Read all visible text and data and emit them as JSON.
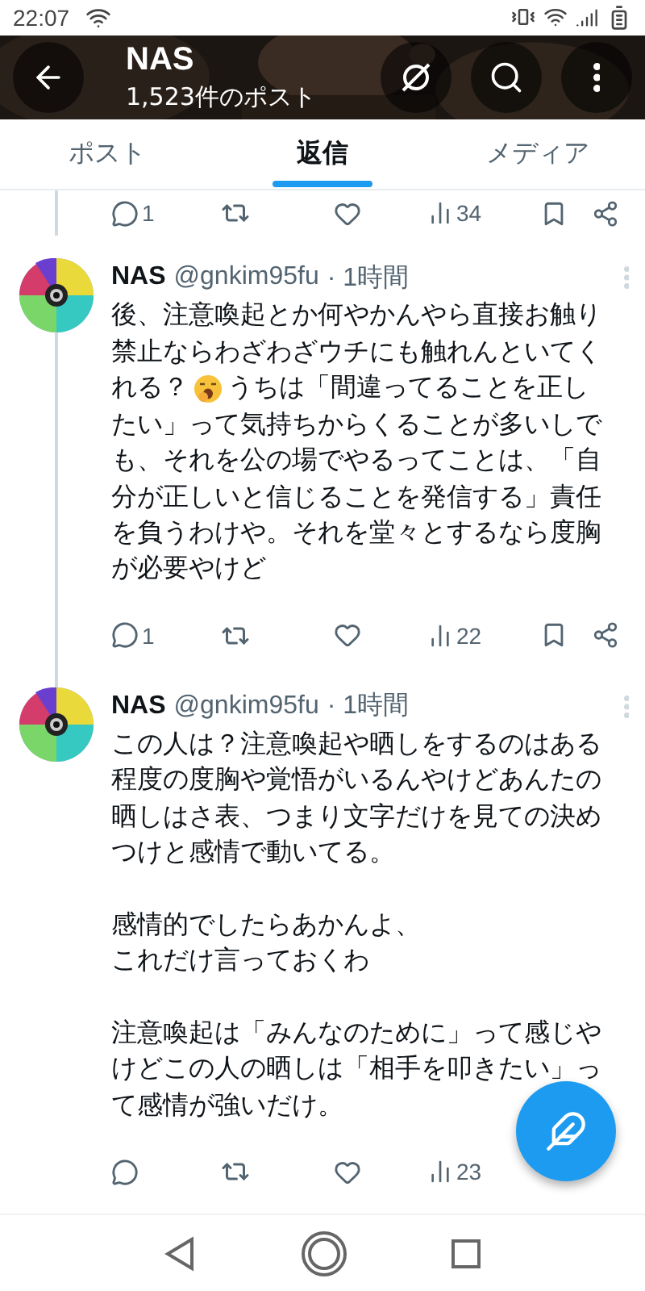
{
  "status_bar": {
    "time": "22:07"
  },
  "header": {
    "title": "NAS",
    "subtitle": "1,523件のポスト"
  },
  "tabs": [
    {
      "label": "ポスト",
      "selected": false
    },
    {
      "label": "返信",
      "selected": true
    },
    {
      "label": "メディア",
      "selected": false
    }
  ],
  "previous_actions": [
    {
      "kind": "reply",
      "count": "1"
    },
    {
      "kind": "retweet"
    },
    {
      "kind": "like"
    },
    {
      "kind": "views",
      "count": "34"
    },
    {
      "kind": "bookmark"
    },
    {
      "kind": "share"
    }
  ],
  "tweets": [
    {
      "name": "NAS",
      "handle": "@gnkim95fu",
      "time": "· 1時間",
      "thread_below": true,
      "blocks": [
        {
          "kind": "text",
          "text": "後、注意喚起とか何やかんやら直接お触り禁止ならわざわざウチにも触れんといてく"
        },
        {
          "kind": "emoji_line",
          "before": "れる？",
          "after": "うちは「間違ってることを正し"
        },
        {
          "kind": "text",
          "text": "たい」って気持ちからくることが多いしでも、それを公の場でやるってことは、「自分が正しいと信じることを発信する」責任を負うわけや。それを堂々とするなら度胸が必要やけど"
        }
      ],
      "actions": [
        {
          "kind": "reply",
          "count": "1"
        },
        {
          "kind": "retweet"
        },
        {
          "kind": "like"
        },
        {
          "kind": "views",
          "count": "22"
        },
        {
          "kind": "bookmark"
        },
        {
          "kind": "share"
        }
      ]
    },
    {
      "name": "NAS",
      "handle": "@gnkim95fu",
      "time": "· 1時間",
      "thread_below": false,
      "blocks": [
        {
          "kind": "text",
          "text": "この人は？注意喚起や晒しをするのはある程度の度胸や覚悟がいるんやけどあんたの晒しはさ表、つまり文字だけを見ての決めつけと感情で動いてる。"
        },
        {
          "kind": "gap"
        },
        {
          "kind": "text",
          "text": "感情的でしたらあかんよ、"
        },
        {
          "kind": "text",
          "text": "これだけ言っておくわ"
        },
        {
          "kind": "gap"
        },
        {
          "kind": "text",
          "text": "注意喚起は「みんなのために」って感じやけどこの人の晒しは「相手を叩きたい」って感情が強いだけ。"
        }
      ],
      "actions": [
        {
          "kind": "reply"
        },
        {
          "kind": "retweet"
        },
        {
          "kind": "like"
        },
        {
          "kind": "views",
          "count": "23"
        }
      ]
    }
  ]
}
